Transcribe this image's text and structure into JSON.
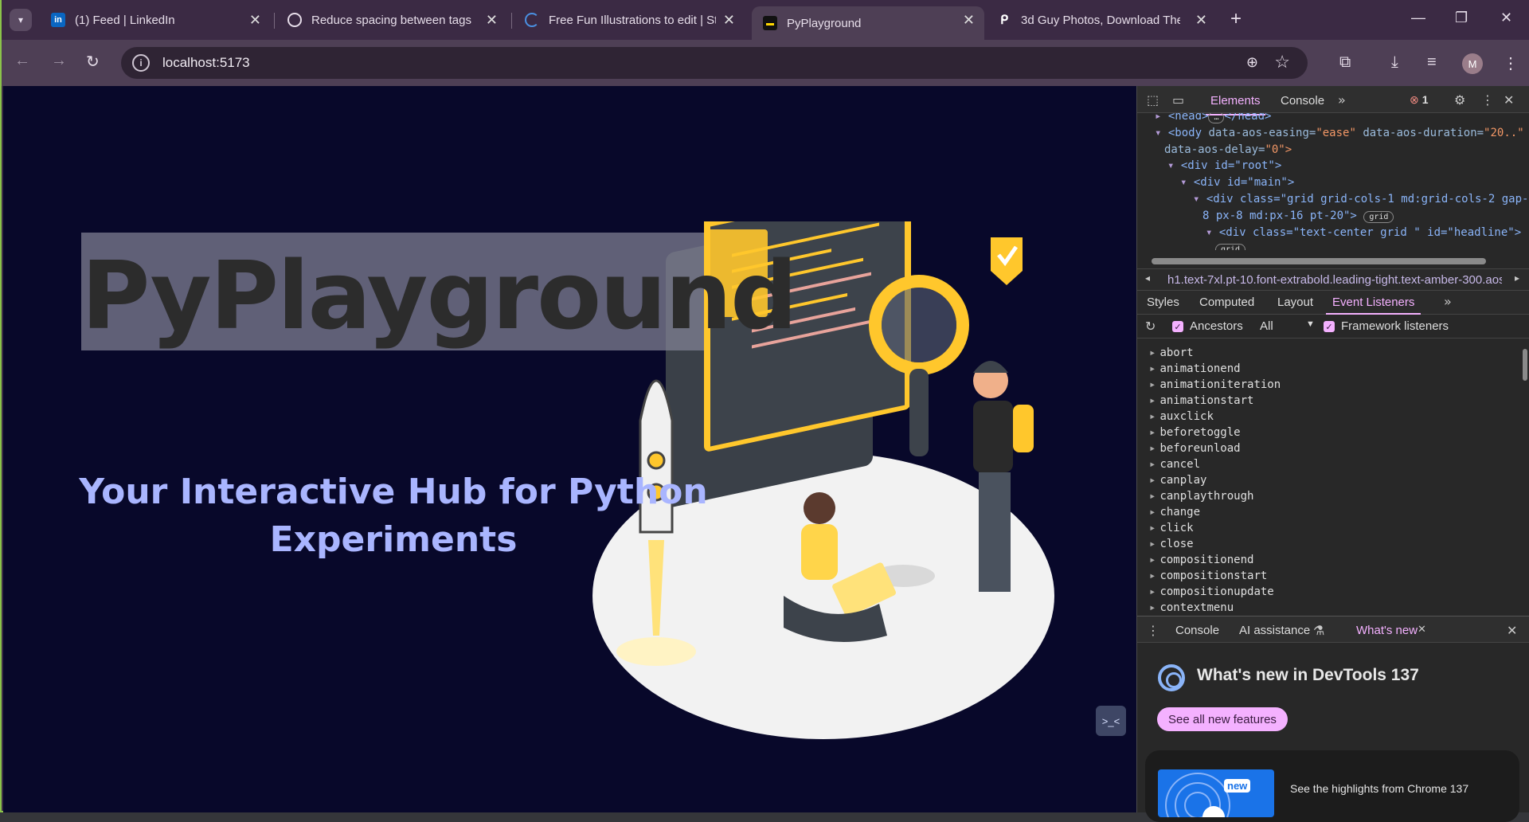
{
  "browser": {
    "tabs": [
      {
        "title": "(1) Feed | LinkedIn",
        "favicon": "in"
      },
      {
        "title": "Reduce spacing between tags",
        "favicon": "openai-icon"
      },
      {
        "title": "Free Fun Illustrations to edit | St",
        "favicon": "loading-icon"
      },
      {
        "title": "PyPlayground",
        "favicon": "vite-icon"
      },
      {
        "title": "3d Guy Photos, Download The F",
        "favicon": "freepik-icon"
      }
    ],
    "active_tab": 3,
    "url": "localhost:5173",
    "avatar_letter": "M",
    "accent": "#8bc34a"
  },
  "page": {
    "headline": "PyPlayground",
    "subhead_line1": "Your Interactive Hub for Python",
    "subhead_line2": "Experiments",
    "float_button": ">_<",
    "bg_color": "#08082a",
    "subhead_color": "#a9b5ff"
  },
  "devtools": {
    "top_tabs": [
      "Elements",
      "Console"
    ],
    "error_count": "1",
    "dom_lines": {
      "head": "<head>",
      "head_close": "</head>",
      "body_tag": "<body",
      "body_attr1": "data-aos-easing=",
      "body_val1": "\"ease\"",
      "body_attr2": "data-aos-duration=",
      "body_val2": "\"20..\"",
      "body_attr3": "data-aos-delay=",
      "body_val3": "\"0\">",
      "root": "<div id=\"root\">",
      "main": "<div id=\"main\">",
      "grid_div": "<div class=\"grid grid-cols-1 md:grid-cols-2 gap-",
      "grid_div2": "8 px-8 md:px-16 pt-20\">",
      "grid_badge": "grid",
      "headline_div": "<div class=\"text-center grid \" id=\"headline\">",
      "headline_badge": "grid"
    },
    "breadcrumb": "h1.text-7xl.pt-10.font-extrabold.leading-tight.text-amber-300.aos",
    "sub_tabs": [
      "Styles",
      "Computed",
      "Layout",
      "Event Listeners"
    ],
    "filters": {
      "ancestors": "Ancestors",
      "scope": "All",
      "framework": "Framework listeners"
    },
    "events": [
      "abort",
      "animationend",
      "animationiteration",
      "animationstart",
      "auxclick",
      "beforetoggle",
      "beforeunload",
      "cancel",
      "canplay",
      "canplaythrough",
      "change",
      "click",
      "close",
      "compositionend",
      "compositionstart",
      "compositionupdate",
      "contextmenu"
    ],
    "drawer_tabs": [
      "Console",
      "AI assistance",
      "What's new"
    ],
    "whats_new_title": "What's new in DevTools 137",
    "see_all_button": "See all new features",
    "card_badge": "new",
    "card_text": "See the highlights from Chrome 137"
  }
}
